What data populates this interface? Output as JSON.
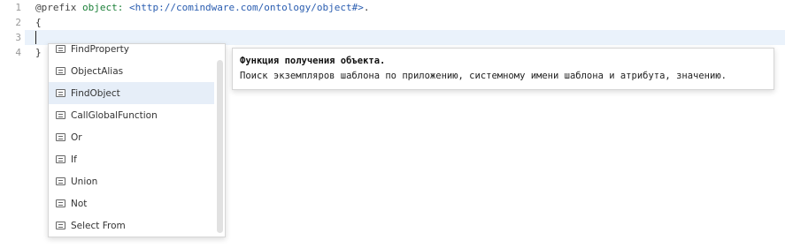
{
  "editor": {
    "line_numbers": [
      "1",
      "2",
      "3",
      "4"
    ],
    "lines": {
      "l1": {
        "keyword": "@prefix",
        "ns": "object:",
        "uri": "<http://comindware.com/ontology/object#>",
        "tail": "."
      },
      "l2": "{",
      "l3": "",
      "l4": "}"
    }
  },
  "autocomplete": {
    "items": [
      {
        "label": "FindProperty"
      },
      {
        "label": "ObjectAlias"
      },
      {
        "label": "FindObject"
      },
      {
        "label": "CallGlobalFunction"
      },
      {
        "label": "Or"
      },
      {
        "label": "If"
      },
      {
        "label": "Union"
      },
      {
        "label": "Not"
      },
      {
        "label": "Select From"
      }
    ],
    "selected_label": "FindObject",
    "item_icon": "method-icon"
  },
  "tooltip": {
    "title": "Функция получения объекта.",
    "description": "Поиск экземпляров шаблона по приложению, системному имени шаблона и атрибута, значению."
  }
}
